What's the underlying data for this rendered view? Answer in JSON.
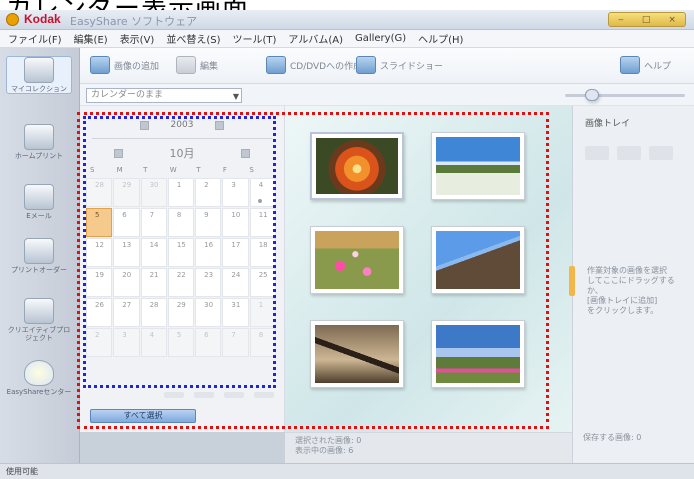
{
  "page_heading": "カレンダー表示画面",
  "window": {
    "brand": "Kodak",
    "app_title": "EasyShare ソフトウェア",
    "controls": [
      "‒",
      "□",
      "×"
    ]
  },
  "menu": [
    "ファイル(F)",
    "編集(E)",
    "表示(V)",
    "並べ替え(S)",
    "ツール(T)",
    "アルバム(A)",
    "Gallery(G)",
    "ヘルプ(H)"
  ],
  "toolbar": {
    "import_label": "画像の追加",
    "edit_label": "編集",
    "cd_label": "CD/DVDへの作成",
    "slideshow_label": "スライドショー",
    "help_label": "ヘルプ"
  },
  "subbar": {
    "view_combo_value": "カレンダーのまま",
    "arrow": "▼"
  },
  "nav": [
    {
      "label": "マイコレクション"
    },
    {
      "label": "ホームプリント"
    },
    {
      "label": "Eメール"
    },
    {
      "label": "プリントオーダー"
    },
    {
      "label": "クリエイティブプロジェクト"
    },
    {
      "label": "EasyShareセンター"
    }
  ],
  "calendar": {
    "year": "2003",
    "month": "10月",
    "weekdays": [
      "S",
      "M",
      "T",
      "W",
      "T",
      "F",
      "S"
    ],
    "weeks": [
      [
        {
          "d": "28",
          "o": true
        },
        {
          "d": "29",
          "o": true
        },
        {
          "d": "30",
          "o": true
        },
        {
          "d": "1"
        },
        {
          "d": "2"
        },
        {
          "d": "3"
        },
        {
          "d": "4",
          "dot": true
        }
      ],
      [
        {
          "d": "5",
          "today": true
        },
        {
          "d": "6"
        },
        {
          "d": "7"
        },
        {
          "d": "8"
        },
        {
          "d": "9"
        },
        {
          "d": "10"
        },
        {
          "d": "11"
        }
      ],
      [
        {
          "d": "12"
        },
        {
          "d": "13"
        },
        {
          "d": "14"
        },
        {
          "d": "15"
        },
        {
          "d": "16"
        },
        {
          "d": "17"
        },
        {
          "d": "18"
        }
      ],
      [
        {
          "d": "19"
        },
        {
          "d": "20"
        },
        {
          "d": "21"
        },
        {
          "d": "22"
        },
        {
          "d": "23"
        },
        {
          "d": "24"
        },
        {
          "d": "25"
        }
      ],
      [
        {
          "d": "26"
        },
        {
          "d": "27"
        },
        {
          "d": "28"
        },
        {
          "d": "29"
        },
        {
          "d": "30"
        },
        {
          "d": "31"
        },
        {
          "d": "1",
          "o": true
        }
      ],
      [
        {
          "d": "2",
          "o": true
        },
        {
          "d": "3",
          "o": true
        },
        {
          "d": "4",
          "o": true
        },
        {
          "d": "5",
          "o": true
        },
        {
          "d": "6",
          "o": true
        },
        {
          "d": "7",
          "o": true
        },
        {
          "d": "8",
          "o": true
        }
      ]
    ],
    "select_all": "すべて選択"
  },
  "photos": [
    {
      "name": "photo-flower",
      "cls": "ph-flower",
      "selected": true
    },
    {
      "name": "photo-field",
      "cls": "ph-field"
    },
    {
      "name": "photo-cosmos",
      "cls": "ph-cosmos"
    },
    {
      "name": "photo-building",
      "cls": "ph-building"
    },
    {
      "name": "photo-silhouette",
      "cls": "ph-silhouette"
    },
    {
      "name": "photo-sky",
      "cls": "ph-sky"
    }
  ],
  "status": {
    "selected_line": "選択された画像: 0",
    "displayed_line": "表示中の画像: 6"
  },
  "tray": {
    "title": "画像トレイ",
    "help_lines": [
      "作業対象の画像を選択",
      "してここにドラッグするか、",
      "[画像トレイに追加]",
      "をクリックします。"
    ],
    "footer": "保存する画像: 0"
  },
  "statusbar": "使用可能",
  "colors": {
    "highlight_blue": "#1e26d8",
    "highlight_red": "#e01010",
    "brand": "#c8102e"
  }
}
